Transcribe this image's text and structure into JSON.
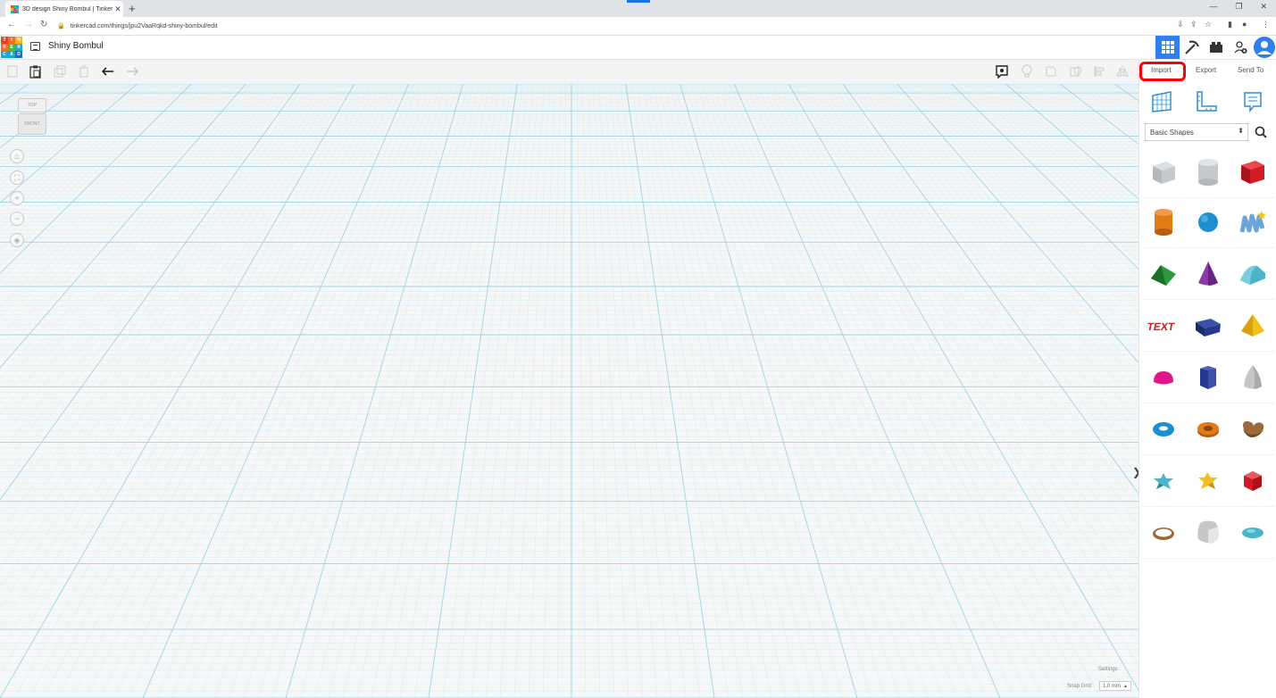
{
  "browser": {
    "tab_title": "3D design Shiny Bombul | Tinker...",
    "url": "tinkercad.com/things/jpu2VaaRqkd-shiny-bombul/edit"
  },
  "app": {
    "logo_letters": [
      "T",
      "I",
      "N",
      "K",
      "E",
      "R",
      "C",
      "A",
      "D"
    ],
    "design_title": "Shiny Bombul"
  },
  "panel": {
    "tabs": {
      "import": "Import",
      "export": "Export",
      "send_to": "Send To"
    },
    "shape_category": "Basic Shapes",
    "shapes": [
      {
        "name": "box-hole",
        "color": "#b8bcc0"
      },
      {
        "name": "cylinder-hole",
        "color": "#b8bcc0"
      },
      {
        "name": "box",
        "color": "#d11c24"
      },
      {
        "name": "cylinder",
        "color": "#e07b1a"
      },
      {
        "name": "sphere",
        "color": "#1b8fd0"
      },
      {
        "name": "scribble",
        "color": "#6aa6d8"
      },
      {
        "name": "roof",
        "color": "#2f9a3c"
      },
      {
        "name": "cone",
        "color": "#8c3aa8"
      },
      {
        "name": "round-roof",
        "color": "#4ab4c8"
      },
      {
        "name": "text",
        "color": "#d11c24"
      },
      {
        "name": "wedge",
        "color": "#253a8c"
      },
      {
        "name": "pyramid",
        "color": "#f2c01a"
      },
      {
        "name": "half-sphere",
        "color": "#e0168a"
      },
      {
        "name": "polygon",
        "color": "#253a8c"
      },
      {
        "name": "paraboloid",
        "color": "#c4c6c8"
      },
      {
        "name": "torus",
        "color": "#1b8fd0"
      },
      {
        "name": "tube",
        "color": "#e07b1a"
      },
      {
        "name": "heart",
        "color": "#9a6a3c"
      },
      {
        "name": "star",
        "color": "#4ab4c8"
      },
      {
        "name": "star-gold",
        "color": "#f2c01a"
      },
      {
        "name": "icosahedron",
        "color": "#d11c24"
      },
      {
        "name": "ring",
        "color": "#9a6a3c"
      },
      {
        "name": "shape-generator",
        "color": "#c4c6c8"
      },
      {
        "name": "ellipsoid",
        "color": "#4ab4c8"
      }
    ]
  },
  "workplane": {
    "viewcube": {
      "top": "TOP",
      "front": "FRONT"
    },
    "settings_label": "Settings",
    "snap_label": "Snap Grid",
    "snap_value": "1.0 mm"
  }
}
